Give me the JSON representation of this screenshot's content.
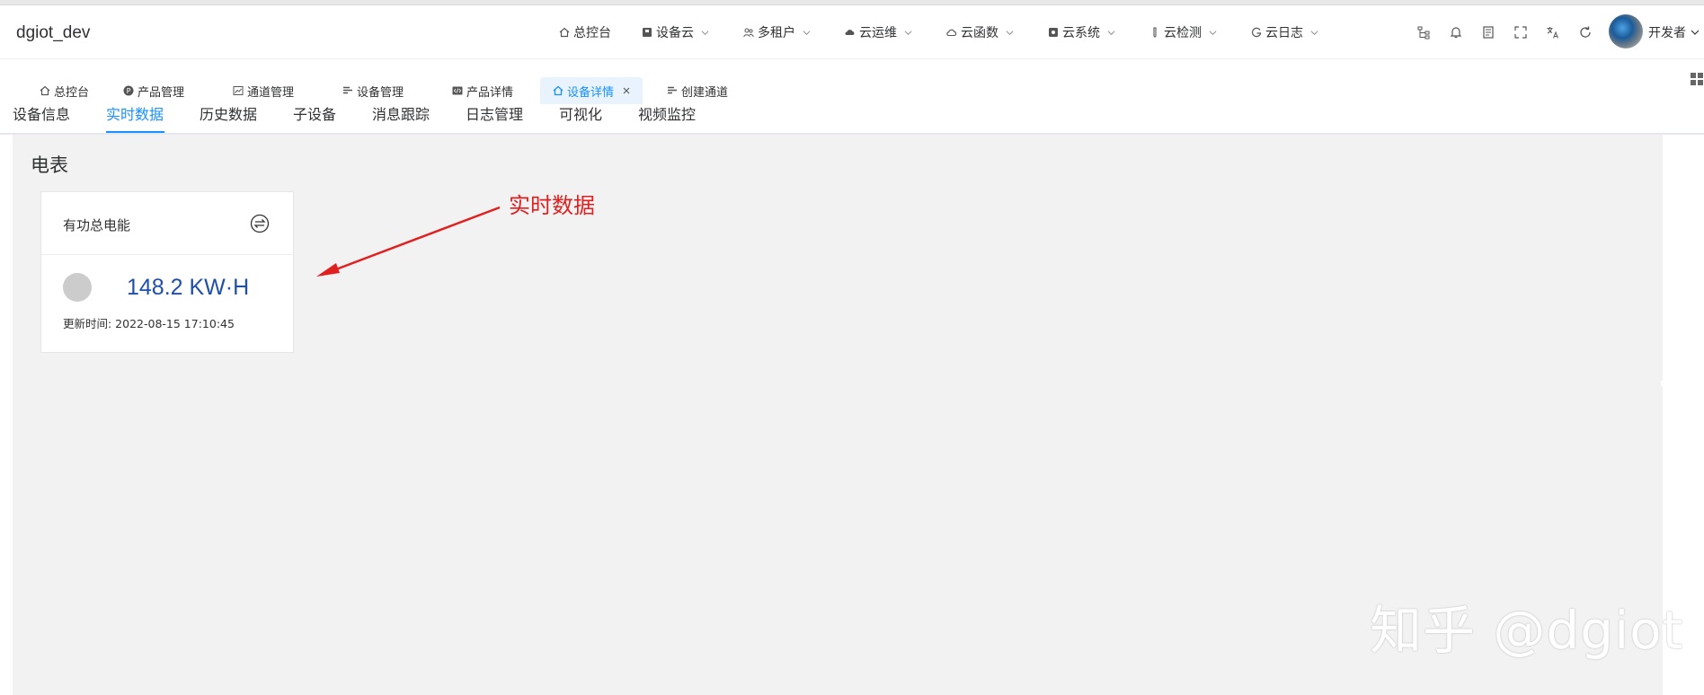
{
  "app": {
    "title": "dgiot_dev"
  },
  "header": {
    "nav": [
      {
        "label": "总控台",
        "icon": "home-icon",
        "has_dropdown": false
      },
      {
        "label": "设备云",
        "icon": "device-cloud-icon",
        "has_dropdown": true
      },
      {
        "label": "多租户",
        "icon": "users-icon",
        "has_dropdown": true
      },
      {
        "label": "云运维",
        "icon": "cloud-ops-icon",
        "has_dropdown": true
      },
      {
        "label": "云函数",
        "icon": "cloud-icon",
        "has_dropdown": true
      },
      {
        "label": "云系统",
        "icon": "system-icon",
        "has_dropdown": true
      },
      {
        "label": "云检测",
        "icon": "test-tube-icon",
        "has_dropdown": true
      },
      {
        "label": "云日志",
        "icon": "log-icon",
        "has_dropdown": true
      }
    ],
    "tools": [
      "sitemap-icon",
      "bell-icon",
      "document-icon",
      "fullscreen-icon",
      "translate-icon",
      "refresh-icon"
    ],
    "user": {
      "name": "开发者"
    }
  },
  "tags": [
    {
      "label": "总控台",
      "icon": "home-icon",
      "active": false
    },
    {
      "label": "产品管理",
      "icon": "product-icon",
      "active": false
    },
    {
      "label": "通道管理",
      "icon": "channel-icon",
      "active": false
    },
    {
      "label": "设备管理",
      "icon": "list-icon",
      "active": false
    },
    {
      "label": "产品详情",
      "icon": "code-icon",
      "active": false
    },
    {
      "label": "设备详情",
      "icon": "home-icon",
      "active": true,
      "closable": true
    },
    {
      "label": "创建通道",
      "icon": "list-icon",
      "active": false
    }
  ],
  "subtabs": [
    {
      "label": "设备信息",
      "active": false
    },
    {
      "label": "实时数据",
      "active": true
    },
    {
      "label": "历史数据",
      "active": false
    },
    {
      "label": "子设备",
      "active": false
    },
    {
      "label": "消息跟踪",
      "active": false
    },
    {
      "label": "日志管理",
      "active": false
    },
    {
      "label": "可视化",
      "active": false
    },
    {
      "label": "视频监控",
      "active": false
    }
  ],
  "section": {
    "title": "电表"
  },
  "card": {
    "title": "有功总电能",
    "value": "148.2 KW·H",
    "time": "更新时间: 2022-08-15 17:10:45"
  },
  "annotation": {
    "text": "实时数据",
    "color": "#e02020"
  },
  "watermark": {
    "text": "知乎 @dgiot"
  },
  "colors": {
    "accent": "#1890ff",
    "value": "#1f4fa8",
    "content_bg": "#f2f2f2"
  }
}
